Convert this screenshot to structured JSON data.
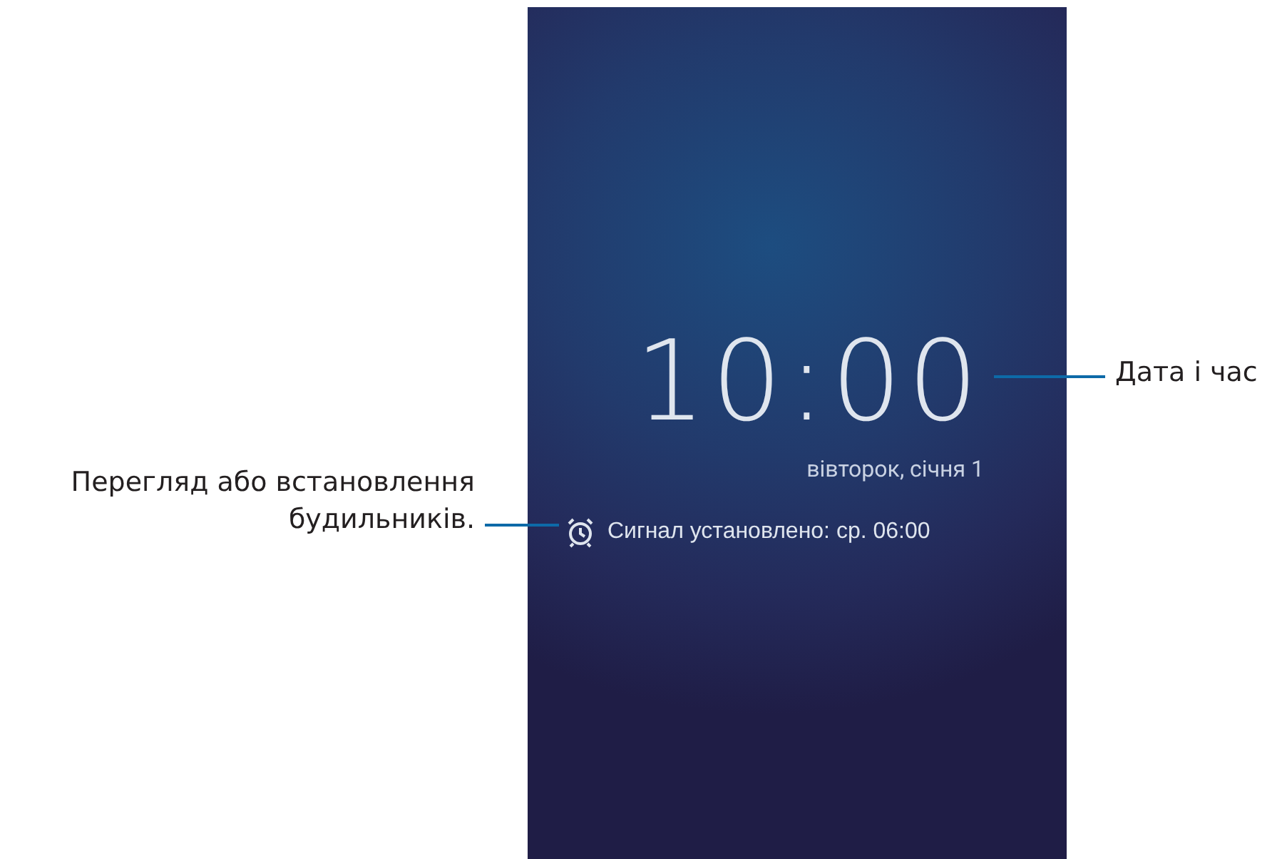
{
  "lock_screen": {
    "time": "10:00",
    "date": "вівторок, січня 1",
    "alarm": "Сигнал установлено: ср. 06:00"
  },
  "clock_callout": "Дата і час",
  "alarm_callout": "Перегляд або встановлення будильників."
}
